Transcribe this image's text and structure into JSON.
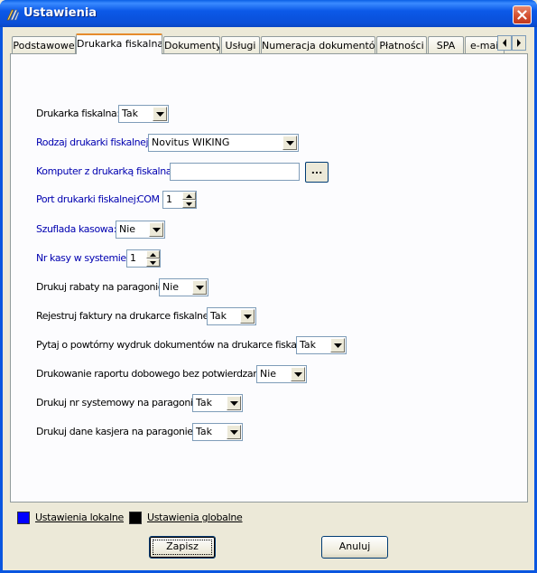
{
  "window": {
    "title": "Ustawienia"
  },
  "tabs": [
    {
      "label": "Podstawowe"
    },
    {
      "label": "Drukarka fiskalna",
      "active": true
    },
    {
      "label": "Dokumenty"
    },
    {
      "label": "Usługi"
    },
    {
      "label": "Numeracja dokumentów"
    },
    {
      "label": "Płatności"
    },
    {
      "label": "SPA"
    },
    {
      "label": "e-mail"
    }
  ],
  "form": {
    "printer": {
      "label": "Drukarka fiskalna:",
      "value": "Tak"
    },
    "printer_type": {
      "label": "Rodzaj drukarki fiskalnej:",
      "value": "Novitus WIKING"
    },
    "computer": {
      "label": "Komputer z drukarką fiskalną:",
      "value": "",
      "browse_label": "..."
    },
    "port": {
      "label": "Port drukarki fiskalnej:",
      "prefix": "COM",
      "value": "1"
    },
    "drawer": {
      "label": "Szuflada kasowa:",
      "value": "Nie"
    },
    "register_no": {
      "label": "Nr kasy w systemie:",
      "value": "1"
    },
    "print_discounts": {
      "label": "Drukuj rabaty na paragonie:",
      "value": "Nie"
    },
    "register_invoices": {
      "label": "Rejestruj faktury na drukarce fiskalnej:",
      "value": "Tak"
    },
    "ask_reprint": {
      "label": "Pytaj o powtórny wydruk dokumentów na drukarce fiskalnej:",
      "value": "Tak"
    },
    "daily_report": {
      "label": "Drukowanie raportu dobowego bez potwierdzania:",
      "value": "Nie"
    },
    "print_sysno": {
      "label": "Drukuj nr systemowy na paragonie:",
      "value": "Tak"
    },
    "print_cashier": {
      "label": "Drukuj dane kasjera na paragonie:",
      "value": "Tak"
    }
  },
  "legend": {
    "local": {
      "label": "Ustawienia lokalne",
      "color": "#0000ff"
    },
    "global": {
      "label": "Ustawienia globalne",
      "color": "#000000"
    }
  },
  "buttons": {
    "save": "Zapisz",
    "cancel": "Anuluj"
  },
  "colors": {
    "local_label": "#0000b0",
    "titlebar": "#0a56e0"
  }
}
